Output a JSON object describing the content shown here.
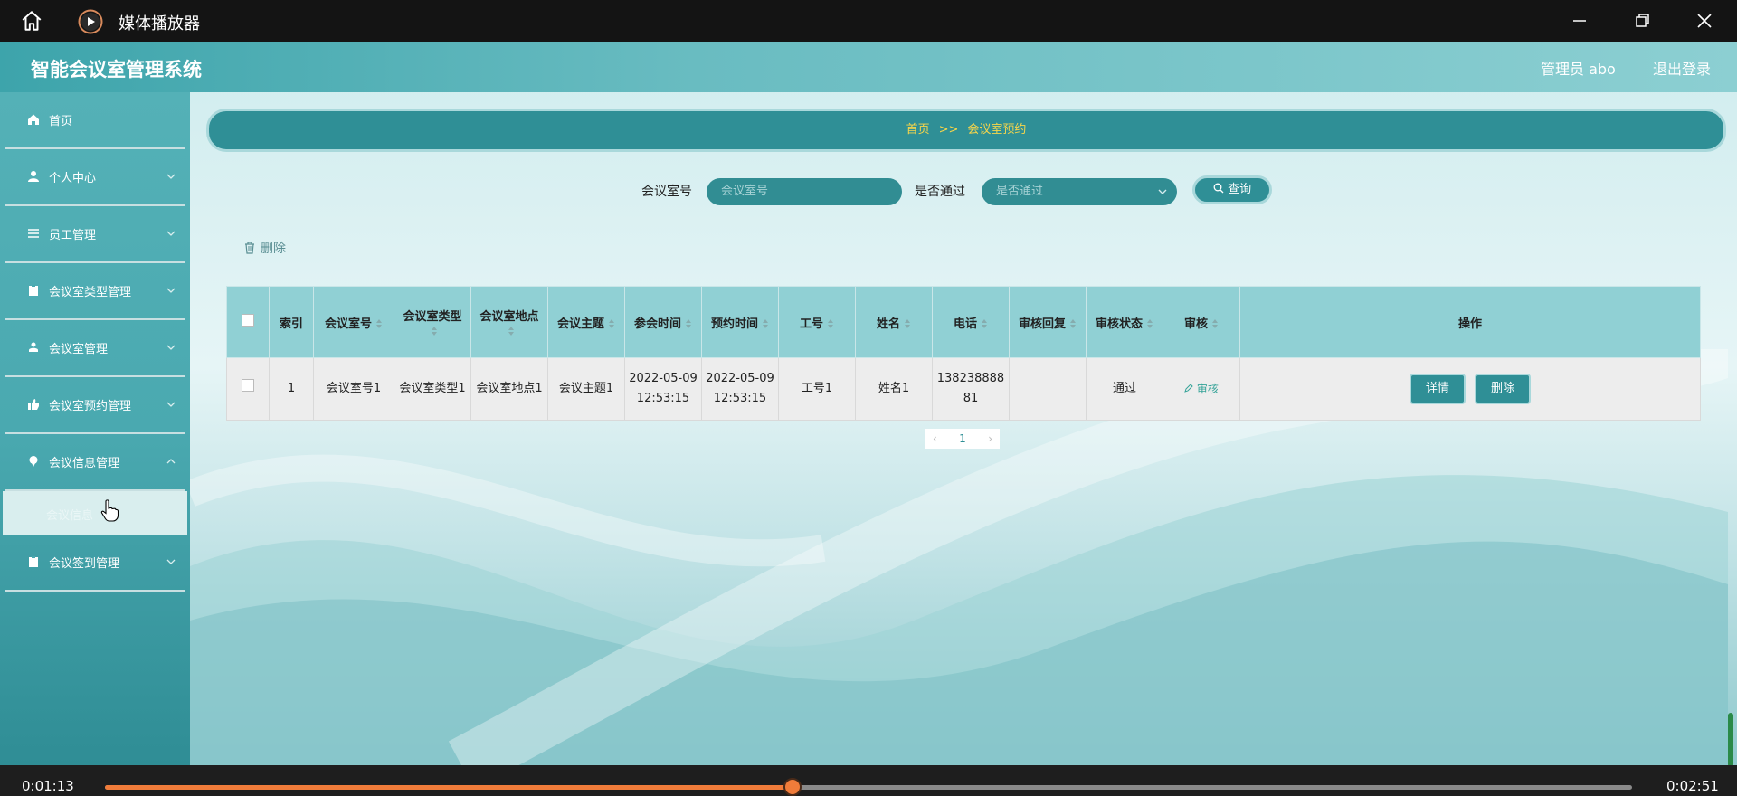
{
  "player": {
    "title": "媒体播放器",
    "current_time": "0:01:13",
    "total_time": "0:02:51",
    "progress": 0.45,
    "accent_color": "#f07c3a"
  },
  "header": {
    "system_title": "智能会议室管理系统",
    "user_label": "管理员 abo",
    "logout_label": "退出登录"
  },
  "sidebar": {
    "items": [
      {
        "label": "首页",
        "icon": "home-icon"
      },
      {
        "label": "个人中心",
        "icon": "user-icon"
      },
      {
        "label": "员工管理",
        "icon": "list-icon"
      },
      {
        "label": "会议室类型管理",
        "icon": "clipboard-icon"
      },
      {
        "label": "会议室管理",
        "icon": "person-icon"
      },
      {
        "label": "会议室预约管理",
        "icon": "thumb-icon"
      },
      {
        "label": "会议信息管理",
        "icon": "pin-icon"
      },
      {
        "label": "会议签到管理",
        "icon": "clipboard-icon"
      }
    ],
    "submenu_label": "会议信息"
  },
  "breadcrumb": {
    "home": "首页",
    "separator": ">>",
    "current": "会议室预约"
  },
  "search": {
    "room_label": "会议室号",
    "room_placeholder": "会议室号",
    "pass_label": "是否通过",
    "pass_placeholder": "是否通过",
    "query_label": "查询"
  },
  "toolbar": {
    "delete_label": "删除"
  },
  "table": {
    "headers": [
      "索引",
      "会议室号",
      "会议室类型",
      "会议室地点",
      "会议主题",
      "参会时间",
      "预约时间",
      "工号",
      "姓名",
      "电话",
      "审核回复",
      "审核状态",
      "审核",
      "操作"
    ],
    "rows": [
      {
        "index": "1",
        "room_no": "会议室号1",
        "room_type": "会议室类型1",
        "room_location": "会议室地点1",
        "topic": "会议主题1",
        "meeting_time_date": "2022-05-09",
        "meeting_time_clock": "12:53:15",
        "booking_time_date": "2022-05-09",
        "booking_time_clock": "12:53:15",
        "staff_no": "工号1",
        "name": "姓名1",
        "phone_line1": "138238888",
        "phone_line2": "81",
        "reply": "",
        "status": "通过",
        "audit_label": "审核",
        "detail_label": "详情",
        "delete_label": "删除"
      }
    ]
  },
  "pagination": {
    "current_page": "1"
  },
  "colors": {
    "primary": "#2f8f96",
    "header_cell": "#90d0d4",
    "breadcrumb_text": "#f7d64a"
  }
}
